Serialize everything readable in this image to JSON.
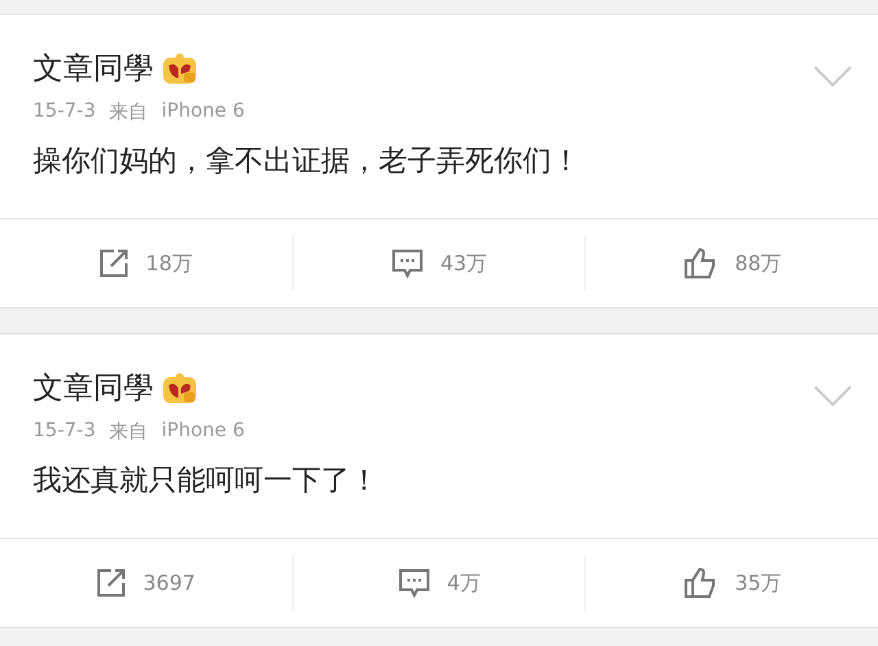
{
  "posts": [
    {
      "author": "文章同學",
      "date": "15-7-3",
      "source_label": "来自",
      "source": "iPhone 6",
      "text": "操你们妈的，拿不出证据，老子弄死你们！",
      "reposts": "18万",
      "comments": "43万",
      "likes": "88万"
    },
    {
      "author": "文章同學",
      "date": "15-7-3",
      "source_label": "来自",
      "source": "iPhone 6",
      "text": "我还真就只能呵呵一下了！",
      "reposts": "3697",
      "comments": "4万",
      "likes": "35万"
    }
  ]
}
